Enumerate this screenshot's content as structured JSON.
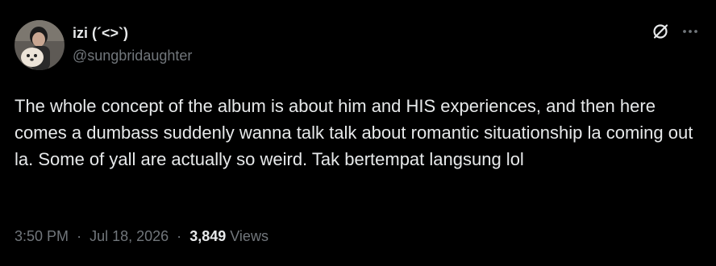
{
  "author": {
    "display_name": "izi (´<>`)",
    "handle": "@sungbridaughter"
  },
  "tweet": {
    "text": "The whole concept of the album is about him and HIS experiences, and then here comes a dumbass suddenly wanna talk talk about romantic situationship la coming out la. Some of yall are actually so weird. Tak bertempat langsung lol"
  },
  "meta": {
    "time": "3:50 PM",
    "separator": "·",
    "date": "Jul 18, 2026",
    "views_count": "3,849",
    "views_label": "Views"
  },
  "icons": {
    "top_actions": [
      "grok-icon",
      "more-icon"
    ]
  },
  "colors": {
    "background": "#000000",
    "primary_text": "#e7e9ea",
    "secondary_text": "#71767b"
  }
}
